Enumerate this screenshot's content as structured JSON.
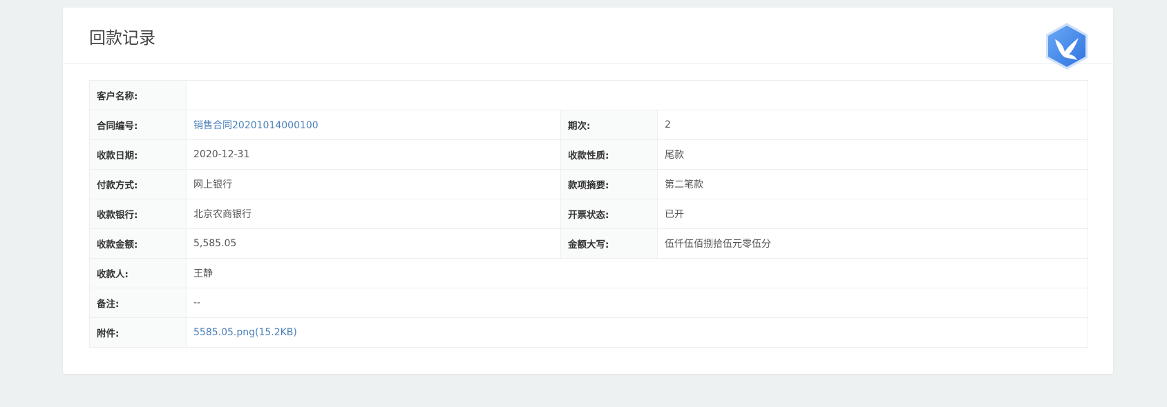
{
  "header": {
    "title": "回款记录"
  },
  "logo": {
    "icon": "bird-hexagon-icon",
    "color": "#4a8fe6"
  },
  "fields": {
    "customer_name": {
      "label": "客户名称:",
      "value": ""
    },
    "contract_no": {
      "label": "合同编号:",
      "value": "销售合同20201014000100"
    },
    "period": {
      "label": "期次:",
      "value": "2"
    },
    "receipt_date": {
      "label": "收款日期:",
      "value": "2020-12-31"
    },
    "receipt_type": {
      "label": "收款性质:",
      "value": "尾款"
    },
    "payment_method": {
      "label": "付款方式:",
      "value": "网上银行"
    },
    "summary": {
      "label": "款项摘要:",
      "value": "第二笔款"
    },
    "bank": {
      "label": "收款银行:",
      "value": "北京农商银行"
    },
    "invoice_status": {
      "label": "开票状态:",
      "value": "已开"
    },
    "amount": {
      "label": "收款金额:",
      "value": "5,585.05"
    },
    "amount_upper": {
      "label": "金额大写:",
      "value": "伍仟伍佰捌拾伍元零伍分"
    },
    "payee": {
      "label": "收款人:",
      "value": "王静"
    },
    "remark": {
      "label": "备注:",
      "value": "--"
    },
    "attachment": {
      "label": "附件:",
      "value": "5585.05.png(15.2KB)"
    }
  },
  "colors": {
    "link": "#4a7fb8",
    "background": "#eef1f2",
    "label_bg": "#f9fafa"
  }
}
